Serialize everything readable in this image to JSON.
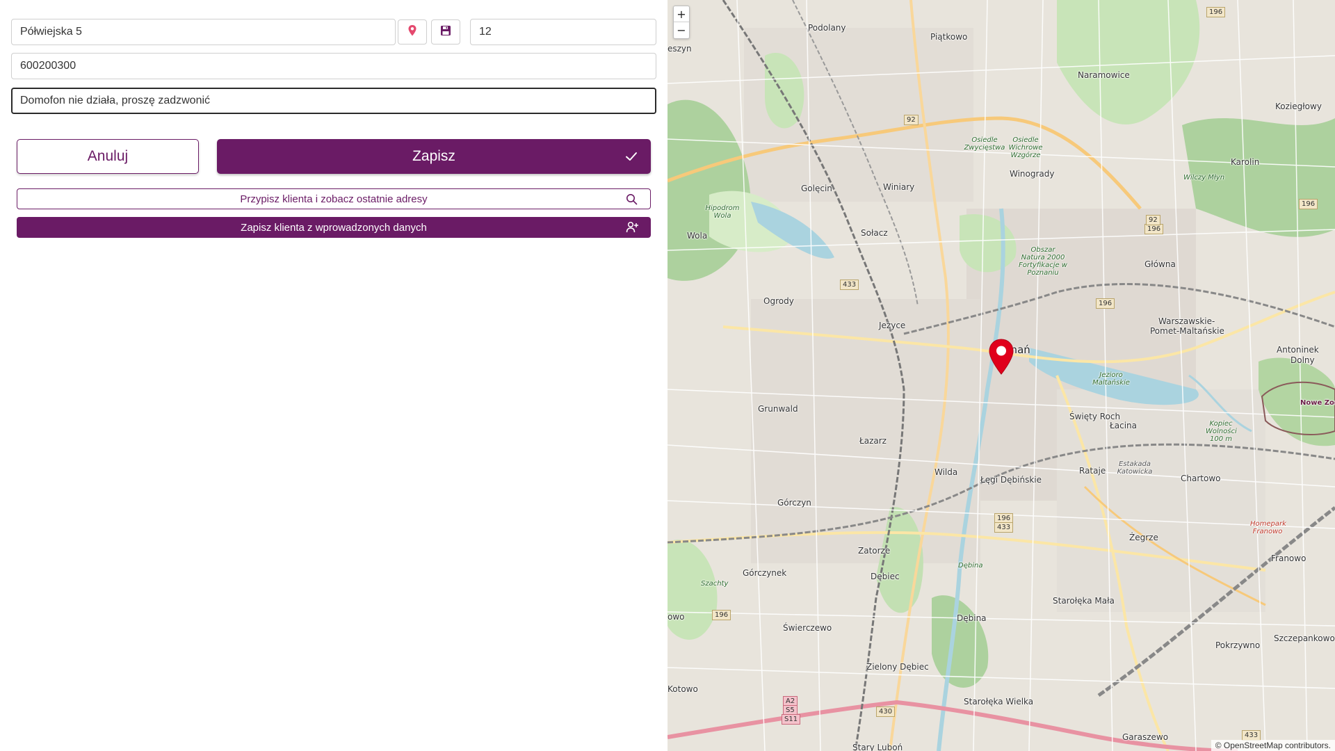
{
  "form": {
    "street_value": "Półwiejska 5",
    "number_value": "12",
    "phone_value": "600200300",
    "note_value": "Domofon nie działa, proszę zadzwonić"
  },
  "icons": {
    "pin": "map-pin-icon",
    "save": "floppy-disk-icon",
    "check": "check-icon",
    "search": "search-icon",
    "add_user": "user-plus-icon"
  },
  "buttons": {
    "cancel": "Anuluj",
    "save": "Zapisz",
    "assign_client": "Przypisz klienta i zobacz ostatnie adresy",
    "save_client": "Zapisz klienta z wprowadzonych danych"
  },
  "map": {
    "zoom_in": "+",
    "zoom_out": "−",
    "attribution": "© OpenStreetMap contributors.",
    "marker_color": "#e0001b",
    "labels": {
      "podolany": "Podolany",
      "piatkowo": "Piątkowo",
      "naramowice": "Naramowice",
      "koziegłowy": "Koziegłowy",
      "winiary": "Winiary",
      "golecin": "Golęcin",
      "winogrady": "Winogrady",
      "karolin": "Karolin",
      "wola": "Wola",
      "solacz": "Sołacz",
      "glowna": "Główna",
      "ogrody": "Ogrody",
      "jezyce": "Jeżyce",
      "poznan": "Poznań",
      "warszawskie": "Warszawskie-",
      "pomet": "Pomet-Maltańskie",
      "antoninek": "Antoninek",
      "dolny": "Dolny",
      "grunwald": "Grunwald",
      "swiety_roch": "Święty Roch",
      "lacina": "Łacina",
      "lazarz": "Łazarz",
      "wilda": "Wilda",
      "legi": "Łęgi Dębińskie",
      "rataje": "Rataje",
      "chartowo": "Chartowo",
      "gorczyn": "Górczyn",
      "zegrze": "Żegrze",
      "franowo": "Franowo",
      "zatorze": "Zatorze",
      "gorczynek": "Górczynek",
      "debiec": "Dębiec",
      "starolęka_mala": "Starołęka Mała",
      "debina": "Dębina",
      "swierczewo": "Świerczewo",
      "pokrzywno": "Pokrzywno",
      "szczepankowo": "Szczepankowo",
      "zielony_debiec": "Zielony Dębiec",
      "kotowo": "Kotowo",
      "starolęka_wielka": "Starołęka Wielka",
      "garaszewo": "Garaszewo",
      "stary_lubon": "Stary Luboń",
      "nowe_zoo": "Nowe Zoo",
      "szyn": "eszyn",
      "owo": "owo"
    },
    "green_labels": {
      "osiedle_zwyc": "Osiedle Zwycięstwa",
      "osiedle_wichr": "Osiedle Wichrowe Wzgórze",
      "obszar": "Obszar Natura 2000 Fortyfikacje w Poznaniu",
      "jezioro": "Jezioro Maltańskie",
      "hipodrom": "Hipodrom Wola",
      "wilczy": "Wilczy Młyn",
      "kopiec": "Kopiec Wolności 100 m",
      "estakada": "Estakada Katowicka",
      "homepark": "Homepark Franowo",
      "debina_park": "Dębina",
      "szachty": "Szachty"
    },
    "shields": {
      "r92": "92",
      "r196a": "196",
      "r196b": "196",
      "r433a": "433",
      "r196433": "196",
      "r433b": "433",
      "r196c": "196",
      "r430": "430",
      "r92b": "92",
      "r196d": "196",
      "a2": "A2",
      "s5": "S5",
      "s11": "S11",
      "r433c": "433",
      "r196e": "196"
    }
  }
}
